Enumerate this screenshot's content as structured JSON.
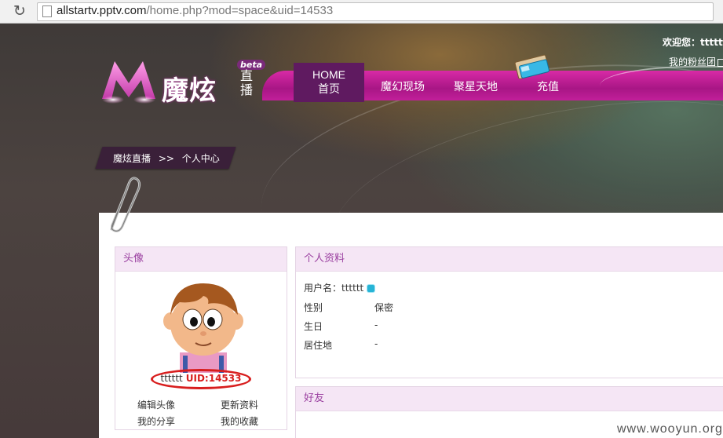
{
  "browser": {
    "url_host": "allstartv.pptv.com",
    "url_path": "/home.php?mod=space&uid=14533"
  },
  "logo": {
    "text": "魔炫",
    "sub": "直播",
    "beta": "beta"
  },
  "nav": {
    "home_en": "HOME",
    "home_cn": "首页",
    "items": [
      "魔幻现场",
      "聚星天地",
      "充值"
    ]
  },
  "top_right": {
    "welcome": "欢迎您：tttttt",
    "fans": "我的粉丝团"
  },
  "breadcrumb": {
    "home": "魔炫直播",
    "sep": ">>",
    "current": "个人中心"
  },
  "avatar_panel": {
    "title": "头像",
    "username": "tttttt",
    "uid": "UID:14533",
    "links": {
      "edit_avatar": "编辑头像",
      "update_profile": "更新资料",
      "my_share": "我的分享",
      "my_fav": "我的收藏"
    }
  },
  "profile_panel": {
    "title": "个人资料",
    "username_label": "用户名：",
    "username": "tttttt",
    "fields": [
      {
        "label": "性别",
        "value": "保密"
      },
      {
        "label": "生日",
        "value": "-"
      },
      {
        "label": "居住地",
        "value": "-"
      }
    ]
  },
  "friends_panel": {
    "title": "好友"
  },
  "watermark": "www.wooyun.org",
  "colors": {
    "nav": "#c21f9a",
    "home_tab": "#5f1a60",
    "panel_head": "#f5e6f5",
    "uid_red": "#d81e1e"
  }
}
